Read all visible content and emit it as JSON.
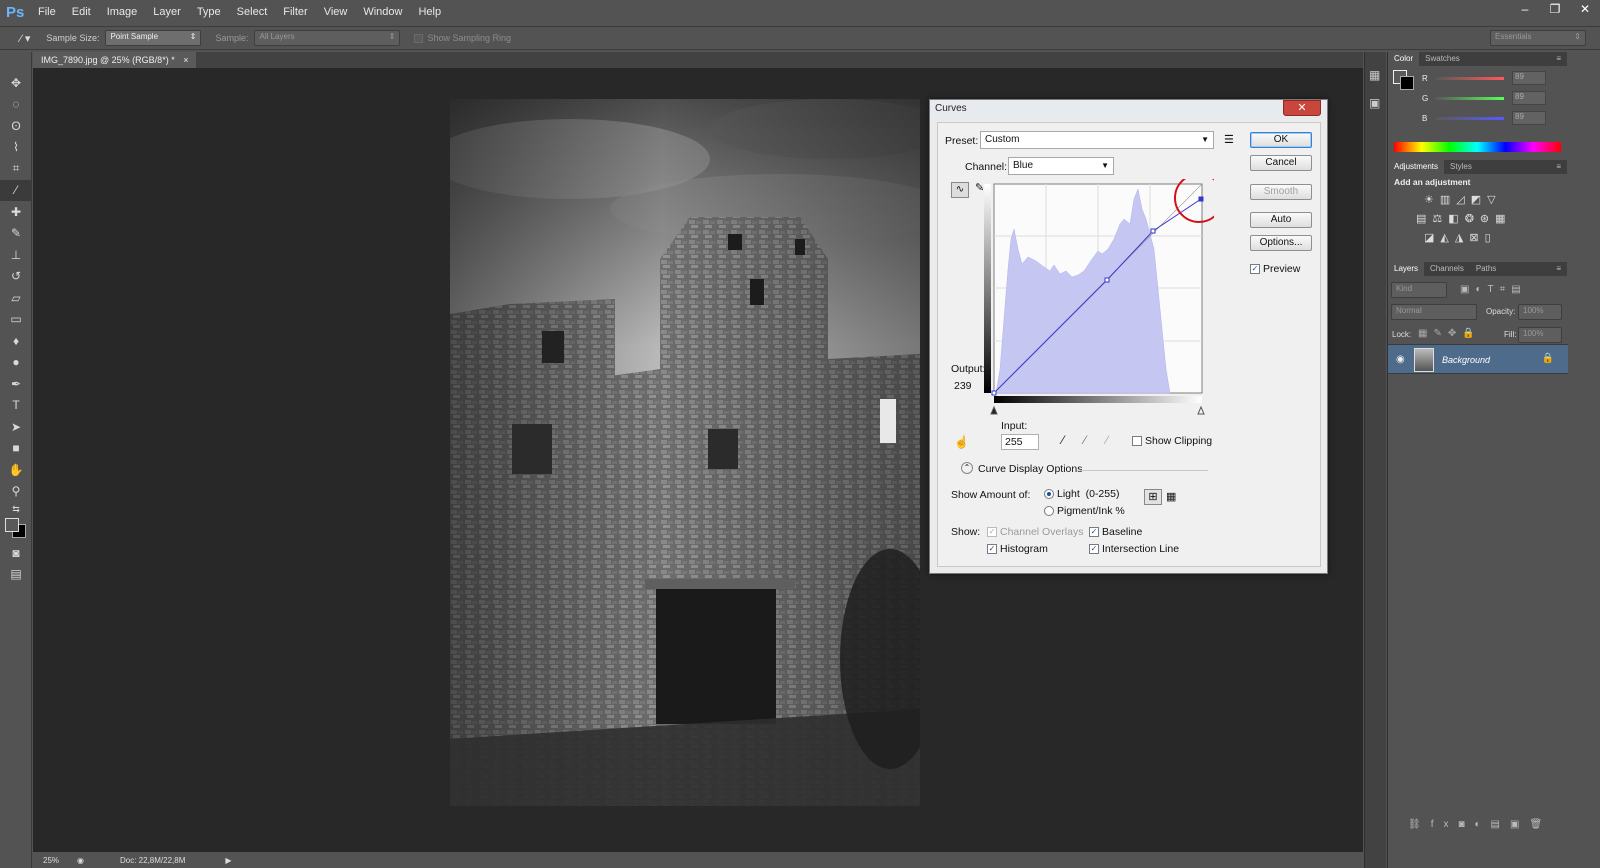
{
  "app": {
    "logo": "Ps",
    "menu": [
      "File",
      "Edit",
      "Image",
      "Layer",
      "Type",
      "Select",
      "Filter",
      "View",
      "Window",
      "Help"
    ],
    "window_controls": [
      "–",
      "❐",
      "✕"
    ]
  },
  "options_bar": {
    "sample_size_label": "Sample Size:",
    "sample_size_value": "Point Sample",
    "sample_label": "Sample:",
    "sample_value": "All Layers",
    "sampling_ring_label": "Show Sampling Ring",
    "workspace": "Essentials"
  },
  "document": {
    "tab_title": "IMG_7890.jpg @ 25% (RGB/8*) *",
    "tab_close": "×"
  },
  "status": {
    "zoom": "25%",
    "doc_size": "Doc: 22,8M/22,8M"
  },
  "panels": {
    "color_tabs": [
      "Color",
      "Swatches"
    ],
    "color_rows": [
      {
        "label": "R",
        "value": "89"
      },
      {
        "label": "G",
        "value": "89"
      },
      {
        "label": "B",
        "value": "89"
      }
    ],
    "adjust_tabs": [
      "Adjustments",
      "Styles"
    ],
    "add_adjustment": "Add an adjustment",
    "layers_tabs": [
      "Layers",
      "Channels",
      "Paths"
    ],
    "kind_filter": "Kind",
    "blend_mode": "Normal",
    "opacity_label": "Opacity:",
    "opacity_value": "100%",
    "lock_label": "Lock:",
    "fill_label": "Fill:",
    "fill_value": "100%",
    "layer_name": "Background"
  },
  "curves": {
    "title": "Curves",
    "close": "✕",
    "preset_label": "Preset:",
    "preset_value": "Custom",
    "channel_label": "Channel:",
    "channel_value": "Blue",
    "output_label": "Output:",
    "output_value": "239",
    "input_label": "Input:",
    "input_value": "255",
    "show_clipping": "Show Clipping",
    "display_options": "Curve Display Options",
    "show_amount_label": "Show Amount of:",
    "light_label": "Light  (0-255)",
    "pigment_label": "Pigment/Ink %",
    "show_label": "Show:",
    "channel_overlays": "Channel Overlays",
    "baseline": "Baseline",
    "histogram": "Histogram",
    "intersection_line": "Intersection Line",
    "buttons": {
      "ok": "OK",
      "cancel": "Cancel",
      "smooth": "Smooth",
      "auto": "Auto",
      "options": "Options...",
      "preview": "Preview"
    },
    "curve_points": [
      {
        "input": 0,
        "output": 0
      },
      {
        "input": 139,
        "output": 138
      },
      {
        "input": 195,
        "output": 196
      },
      {
        "input": 255,
        "output": 239
      }
    ]
  },
  "colors": {
    "accent_blue": "#3b7fd1",
    "histogram_fill": "#c6c6f3",
    "curve_line": "#3636c8",
    "highlight_circle": "#d0111a"
  }
}
